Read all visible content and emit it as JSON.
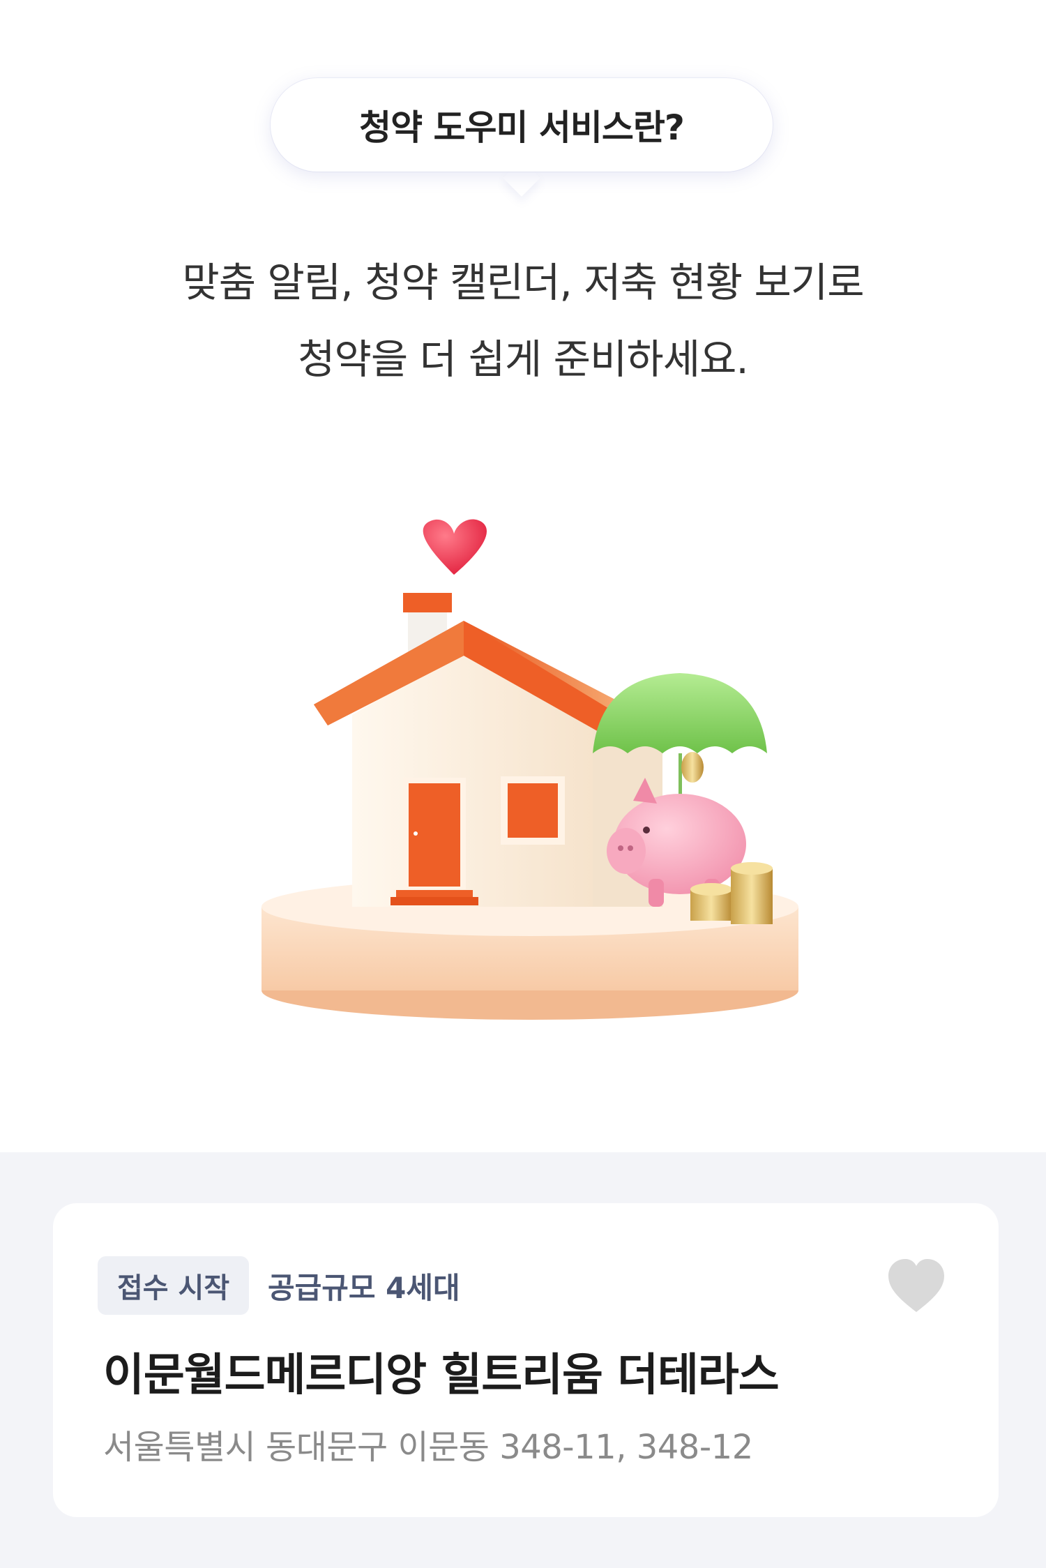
{
  "intro": {
    "bubble_title": "청약 도우미 서비스란?",
    "description_line1": "맞춤 알림, 청약 캘린더, 저축 현황 보기로",
    "description_line2": "청약을 더 쉽게 준비하세요."
  },
  "listing": {
    "status_tag": "접수 시작",
    "supply_info": "공급규모 4세대",
    "title": "이문월드메르디앙 힐트리움 더테라스",
    "address": "서울특별시 동대문구 이문동 348-11, 348-12"
  },
  "colors": {
    "tag_bg": "#eef0f5",
    "tag_text": "#4b5673",
    "page_bg_bottom": "#f3f4f8",
    "heart_inactive": "#d9d9d9",
    "roof": "#f0662a",
    "umbrella": "#8ed66b",
    "piggy": "#f5a9bd"
  },
  "icons": [
    "heart-icon",
    "favorite-heart-icon"
  ]
}
